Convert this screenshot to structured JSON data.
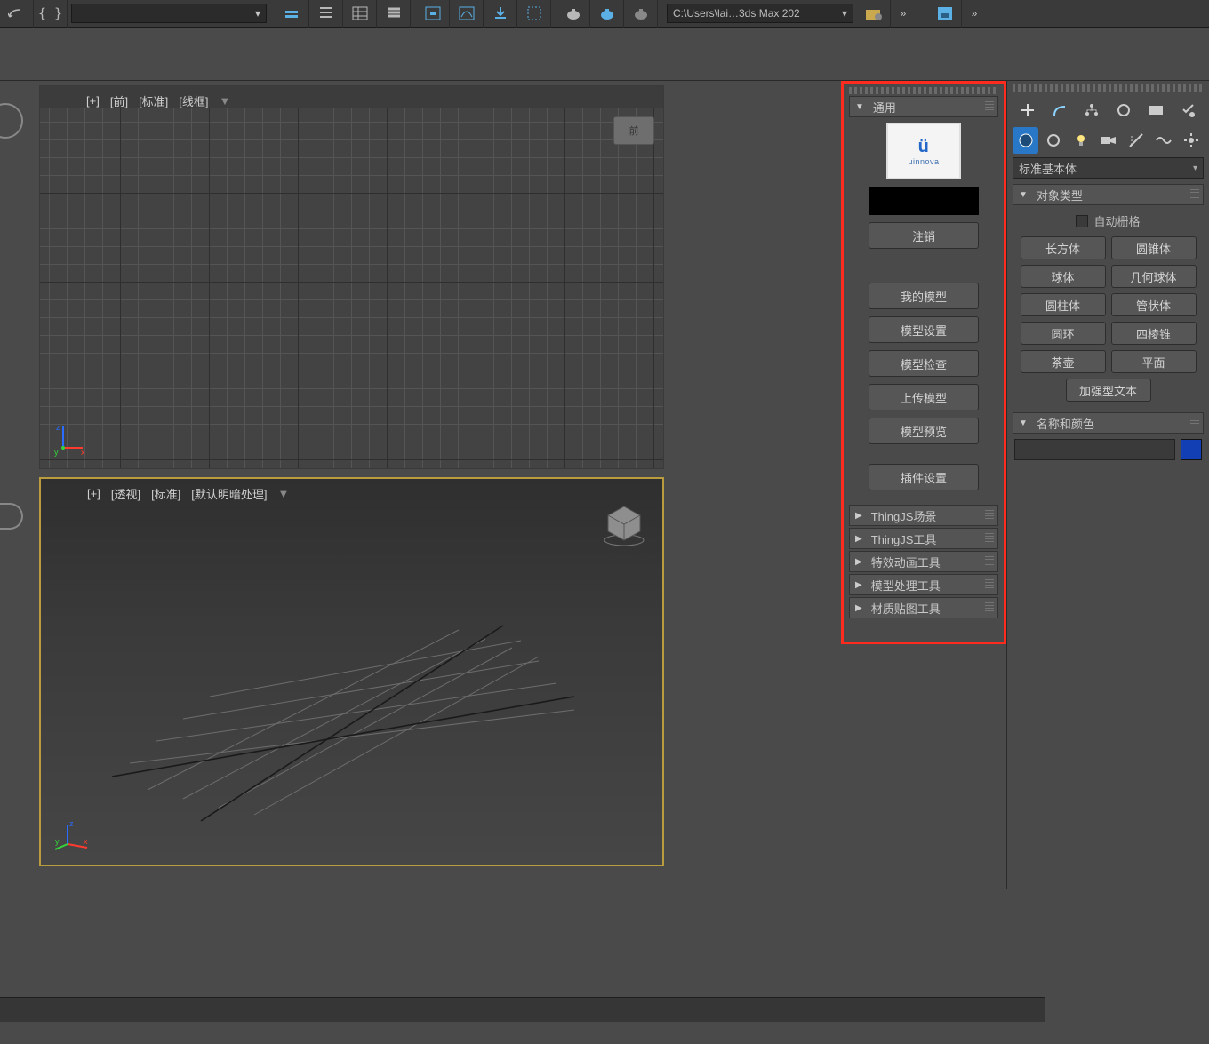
{
  "toolbar": {
    "path": "C:\\Users\\lai…3ds Max 202",
    "dropdown_arrow": "▾",
    "more_glyph": "»"
  },
  "viewport": {
    "top_caption": {
      "plus": "[+]",
      "view": "[前]",
      "std": "[标准]",
      "mode": "[线框]"
    },
    "top_badge": "前",
    "bot_caption": {
      "plus": "[+]",
      "view": "[透视]",
      "std": "[标准]",
      "mode": "[默认明暗处理]"
    },
    "axis": {
      "x": "x",
      "y": "y",
      "z": "z"
    }
  },
  "plugin": {
    "general": "通用",
    "logo_text": "uinnova",
    "logout": "注销",
    "btns": {
      "my_models": "我的模型",
      "model_settings": "模型设置",
      "model_check": "模型检查",
      "upload_model": "上传模型",
      "model_preview": "模型预览",
      "plugin_settings": "插件设置"
    },
    "subrolls": {
      "scene": "ThingJS场景",
      "tools": "ThingJS工具",
      "fx": "特效动画工具",
      "modelproc": "模型处理工具",
      "mattex": "材质贴图工具"
    }
  },
  "cmd": {
    "category": "标准基本体",
    "object_type": "对象类型",
    "autogrid": "自动栅格",
    "primitives": {
      "box": "长方体",
      "cone": "圆锥体",
      "sphere": "球体",
      "geosphere": "几何球体",
      "cylinder": "圆柱体",
      "tube": "管状体",
      "torus": "圆环",
      "pyramid": "四棱锥",
      "teapot": "茶壶",
      "plane": "平面",
      "textplus": "加强型文本"
    },
    "name_color": "名称和颜色",
    "color": "#133fb5"
  }
}
